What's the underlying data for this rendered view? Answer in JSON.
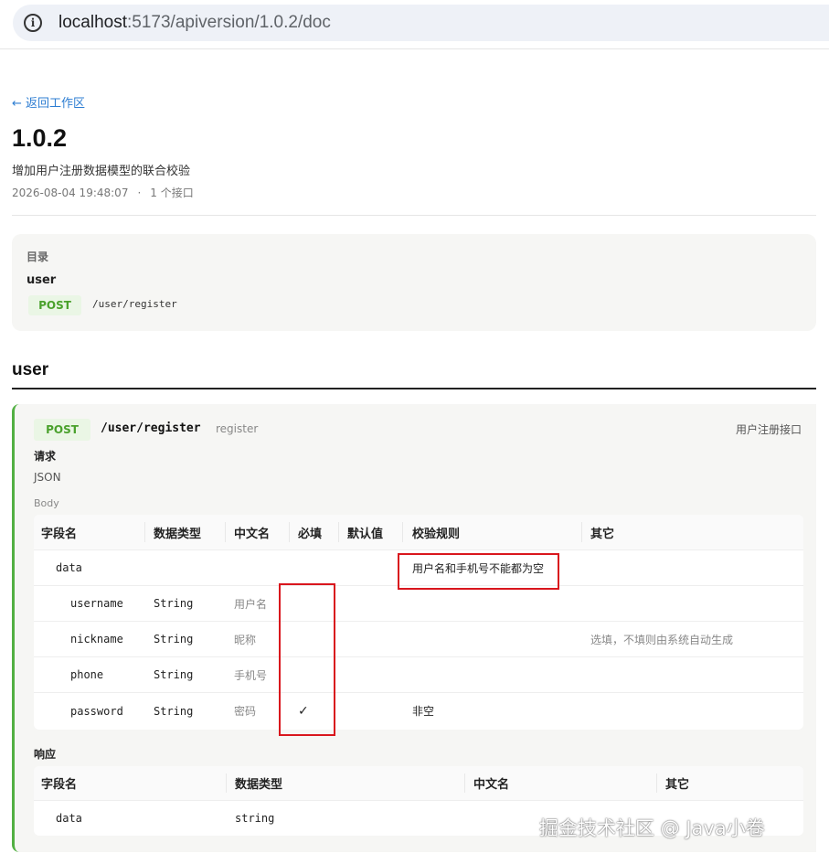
{
  "browser": {
    "url_host": "localhost",
    "url_rest": ":5173/apiversion/1.0.2/doc"
  },
  "page": {
    "back_link": "← 返回工作区",
    "version": "1.0.2",
    "description": "增加用户注册数据模型的联合校验",
    "timestamp": "2026-08-04 19:48:07",
    "separator": "·",
    "interface_count": "1 个接口"
  },
  "toc": {
    "label": "目录",
    "group": "user",
    "method": "POST",
    "path": "/user/register"
  },
  "section": {
    "title": "user"
  },
  "endpoint": {
    "method": "POST",
    "path": "/user/register",
    "name": "register",
    "description": "用户注册接口",
    "request_label": "请求",
    "request_type": "JSON",
    "body_label": "Body",
    "request_columns": [
      "字段名",
      "数据类型",
      "中文名",
      "必填",
      "默认值",
      "校验规则",
      "其它"
    ],
    "request_rows": [
      {
        "field": "data",
        "type": "",
        "cn_name": "",
        "required": "",
        "default": "",
        "rule": "用户名和手机号不能都为空",
        "other": ""
      },
      {
        "field": "username",
        "type": "String",
        "cn_name": "用户名",
        "required": "",
        "default": "",
        "rule": "",
        "other": ""
      },
      {
        "field": "nickname",
        "type": "String",
        "cn_name": "昵称",
        "required": "",
        "default": "",
        "rule": "",
        "other": "选填，不填则由系统自动生成"
      },
      {
        "field": "phone",
        "type": "String",
        "cn_name": "手机号",
        "required": "",
        "default": "",
        "rule": "",
        "other": ""
      },
      {
        "field": "password",
        "type": "String",
        "cn_name": "密码",
        "required": "✓",
        "default": "",
        "rule": "非空",
        "other": ""
      }
    ],
    "response_label": "响应",
    "response_columns": [
      "字段名",
      "数据类型",
      "中文名",
      "其它"
    ],
    "response_rows": [
      {
        "field": "data",
        "type": "string",
        "cn_name": "",
        "other": ""
      }
    ]
  },
  "icons": {
    "info": "info-circle-icon"
  },
  "colors": {
    "method_green": "#4aa12c",
    "method_bg": "#eaf6e5",
    "link_blue": "#2d7dd2",
    "highlight_red": "#d9161d"
  },
  "watermark": "掘金技术社区 @ Java小卷"
}
